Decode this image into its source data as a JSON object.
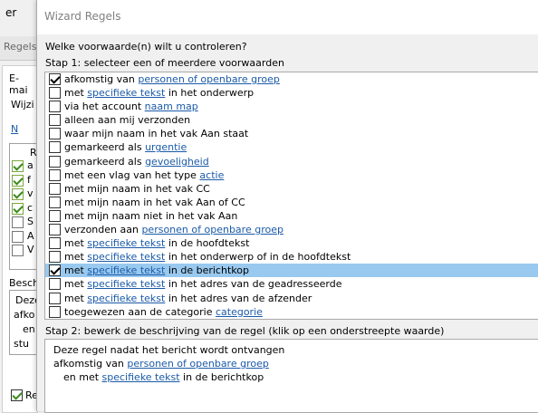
{
  "background_window": {
    "title_fragment": "er",
    "tab_fragment": "Regels",
    "section_fragment": "E-mai",
    "modify_fragment": "Wijzi",
    "toolbar_fragment": "N",
    "column_fragment": "R",
    "rows": [
      {
        "checked": true,
        "text": "a"
      },
      {
        "checked": true,
        "text": "f"
      },
      {
        "checked": true,
        "text": "v"
      },
      {
        "checked": true,
        "text": "c"
      },
      {
        "checked": false,
        "text": "S"
      },
      {
        "checked": false,
        "text": "A"
      },
      {
        "checked": false,
        "text": "V"
      }
    ],
    "desc_label_fragment": "Besch",
    "desc_lines": [
      "Deze",
      "afko",
      "en",
      "stu"
    ],
    "bottom_check_fragment": "Re"
  },
  "dialog": {
    "title": "Wizard Regels",
    "question": "Welke voorwaarde(n) wilt u controleren?",
    "step1": "Stap 1: selecteer een of meerdere voorwaarden",
    "step2": "Stap 2: bewerk de beschrijving van de regel (klik op een onderstreepte waarde)",
    "conditions": [
      {
        "checked": true,
        "before": "afkomstig van ",
        "link": "personen of openbare groep",
        "after": ""
      },
      {
        "checked": false,
        "before": "met ",
        "link": "specifieke tekst",
        "after": " in het onderwerp"
      },
      {
        "checked": false,
        "before": "via het account ",
        "link": "naam map",
        "after": ""
      },
      {
        "checked": false,
        "before": "alleen aan mij verzonden",
        "link": "",
        "after": ""
      },
      {
        "checked": false,
        "before": "waar mijn naam in het vak Aan staat",
        "link": "",
        "after": ""
      },
      {
        "checked": false,
        "before": "gemarkeerd als ",
        "link": "urgentie",
        "after": ""
      },
      {
        "checked": false,
        "before": "gemarkeerd als ",
        "link": "gevoeligheid",
        "after": ""
      },
      {
        "checked": false,
        "before": "met een vlag van het type ",
        "link": "actie",
        "after": ""
      },
      {
        "checked": false,
        "before": "met mijn naam in het vak CC",
        "link": "",
        "after": ""
      },
      {
        "checked": false,
        "before": "met mijn naam in het vak Aan of CC",
        "link": "",
        "after": ""
      },
      {
        "checked": false,
        "before": "met mijn naam niet in het vak Aan",
        "link": "",
        "after": ""
      },
      {
        "checked": false,
        "before": "verzonden aan ",
        "link": "personen of openbare groep",
        "after": ""
      },
      {
        "checked": false,
        "before": "met ",
        "link": "specifieke tekst",
        "after": " in de hoofdtekst"
      },
      {
        "checked": false,
        "before": "met ",
        "link": "specifieke tekst",
        "after": " in het onderwerp of in de hoofdtekst"
      },
      {
        "checked": true,
        "before": "met ",
        "link": "specifieke tekst",
        "after": " in de berichtkop",
        "selected": true
      },
      {
        "checked": false,
        "before": "met ",
        "link": "specifieke tekst",
        "after": " in het adres van de geadresseerde"
      },
      {
        "checked": false,
        "before": "met ",
        "link": "specifieke tekst",
        "after": " in het adres van de afzender"
      },
      {
        "checked": false,
        "before": "toegewezen aan de categorie ",
        "link": "categorie",
        "after": ""
      }
    ],
    "description": {
      "line1": "Deze regel nadat het bericht wordt ontvangen",
      "line2_before": "afkomstig van ",
      "line2_link": "personen of openbare groep",
      "line3_before": "en met ",
      "line3_link": "specifieke tekst",
      "line3_after": " in de berichtkop"
    },
    "selection_color": "#99c9ef",
    "link_color": "#1a5aa8"
  }
}
